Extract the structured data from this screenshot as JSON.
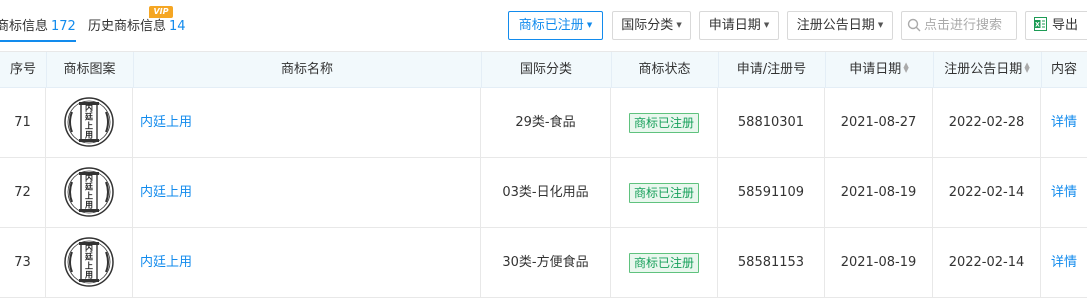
{
  "tabs": [
    {
      "label": "商标信息",
      "count": "172"
    },
    {
      "label": "历史商标信息",
      "count": "14",
      "badge": "VIP"
    }
  ],
  "filters": {
    "registered": "商标已注册",
    "intl_class": "国际分类",
    "apply_date": "申请日期",
    "notice_date": "注册公告日期"
  },
  "search": {
    "placeholder": "点击进行搜索",
    "value": ""
  },
  "export_label": "导出",
  "columns": [
    "序号",
    "商标图案",
    "商标名称",
    "国际分类",
    "商标状态",
    "申请/注册号",
    "申请日期",
    "注册公告日期",
    "内容"
  ],
  "rows": [
    {
      "no": "71",
      "logo_text": "内廷上用",
      "name": "内廷上用",
      "intl_class": "29类-食品",
      "status": "商标已注册",
      "reg_no": "58810301",
      "apply_date": "2021-08-27",
      "notice_date": "2022-02-28",
      "detail": "详情"
    },
    {
      "no": "72",
      "logo_text": "内廷上用",
      "name": "内廷上用",
      "intl_class": "03类-日化用品",
      "status": "商标已注册",
      "reg_no": "58591109",
      "apply_date": "2021-08-19",
      "notice_date": "2022-02-14",
      "detail": "详情"
    },
    {
      "no": "73",
      "logo_text": "内廷上用",
      "name": "内廷上用",
      "intl_class": "30类-方便食品",
      "status": "商标已注册",
      "reg_no": "58581153",
      "apply_date": "2021-08-19",
      "notice_date": "2022-02-14",
      "detail": "详情"
    }
  ],
  "colors": {
    "accent": "#128bed",
    "status_green": "#19a15c",
    "vip": "#f5a623",
    "header_bg": "#f2f9fc"
  },
  "icons": {
    "search": "magnifier-icon",
    "export": "excel-icon",
    "sort": "sort-arrows-icon",
    "dropdown": "caret-down-icon"
  }
}
